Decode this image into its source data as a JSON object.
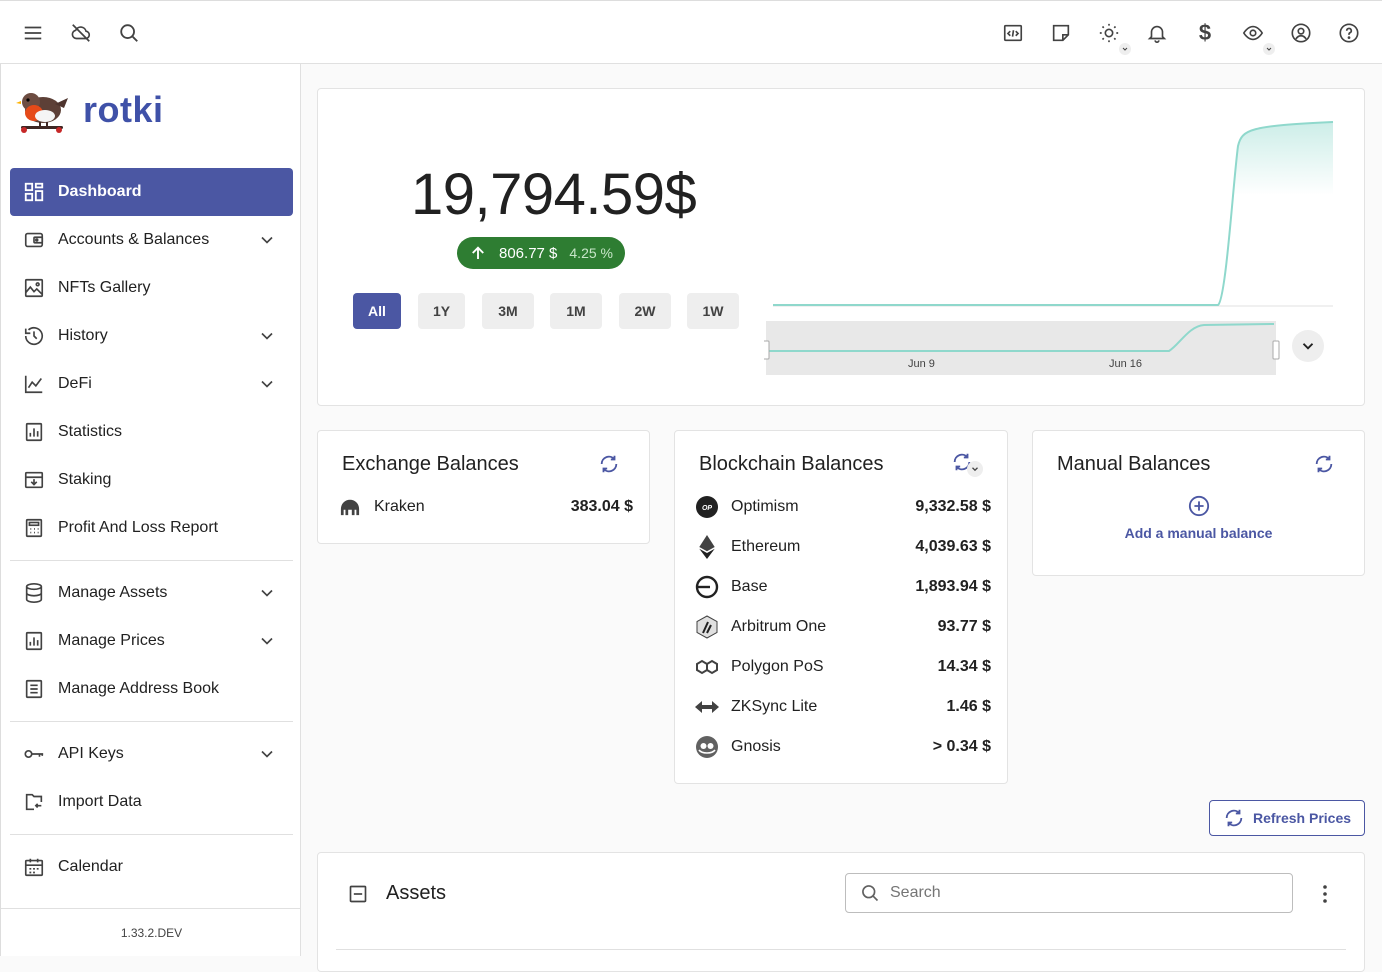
{
  "app": {
    "name": "rotki",
    "version": "1.33.2.DEV"
  },
  "topbar": {
    "icons": [
      "menu-icon",
      "cloud-off-icon",
      "search-icon",
      "code-icon",
      "notes-icon",
      "theme-icon",
      "bell-icon",
      "currency-icon",
      "privacy-icon",
      "account-icon",
      "help-icon"
    ],
    "currency_symbol": "$"
  },
  "sidebar": {
    "items": [
      {
        "label": "Dashboard",
        "icon": "dashboard-icon",
        "active": true
      },
      {
        "label": "Accounts & Balances",
        "icon": "wallet-icon",
        "expandable": true
      },
      {
        "label": "NFTs Gallery",
        "icon": "image-icon"
      },
      {
        "label": "History",
        "icon": "history-icon",
        "expandable": true
      },
      {
        "label": "DeFi",
        "icon": "chart-line-icon",
        "expandable": true
      },
      {
        "label": "Statistics",
        "icon": "statistics-icon"
      },
      {
        "label": "Staking",
        "icon": "staking-icon"
      },
      {
        "label": "Profit And Loss Report",
        "icon": "calculator-icon"
      },
      {
        "label": "Manage Assets",
        "icon": "database-icon",
        "expandable": true
      },
      {
        "label": "Manage Prices",
        "icon": "prices-icon",
        "expandable": true
      },
      {
        "label": "Manage Address Book",
        "icon": "address-book-icon"
      },
      {
        "label": "API Keys",
        "icon": "key-icon",
        "expandable": true
      },
      {
        "label": "Import Data",
        "icon": "import-icon"
      },
      {
        "label": "Calendar",
        "icon": "calendar-icon"
      }
    ]
  },
  "overview": {
    "total_value": "19,794.59",
    "currency_symbol": "$",
    "delta_value": "806.77 $",
    "delta_percent": "4.25 %",
    "periods": [
      "All",
      "1Y",
      "3M",
      "1M",
      "2W",
      "1W"
    ],
    "active_period": "All",
    "timeline_labels": [
      "Jun 9",
      "Jun 16"
    ],
    "accent_color": "#4b57a3",
    "line_color": "#8fd8cc"
  },
  "exchange_balances": {
    "title": "Exchange Balances",
    "items": [
      {
        "name": "Kraken",
        "value": "383.04 $"
      }
    ]
  },
  "blockchain_balances": {
    "title": "Blockchain Balances",
    "items": [
      {
        "name": "Optimism",
        "value": "9,332.58 $",
        "icon": "optimism-icon"
      },
      {
        "name": "Ethereum",
        "value": "4,039.63 $",
        "icon": "ethereum-icon"
      },
      {
        "name": "Base",
        "value": "1,893.94 $",
        "icon": "base-icon"
      },
      {
        "name": "Arbitrum One",
        "value": "93.77 $",
        "icon": "arbitrum-icon"
      },
      {
        "name": "Polygon PoS",
        "value": "14.34 $",
        "icon": "polygon-icon"
      },
      {
        "name": "ZKSync Lite",
        "value": "1.46 $",
        "icon": "zksync-icon"
      },
      {
        "name": "Gnosis",
        "value": "> 0.34 $",
        "icon": "gnosis-icon"
      }
    ]
  },
  "manual_balances": {
    "title": "Manual Balances",
    "add_label": "Add a manual balance"
  },
  "refresh_prices_label": "Refresh Prices",
  "assets": {
    "title": "Assets",
    "search_placeholder": "Search"
  }
}
